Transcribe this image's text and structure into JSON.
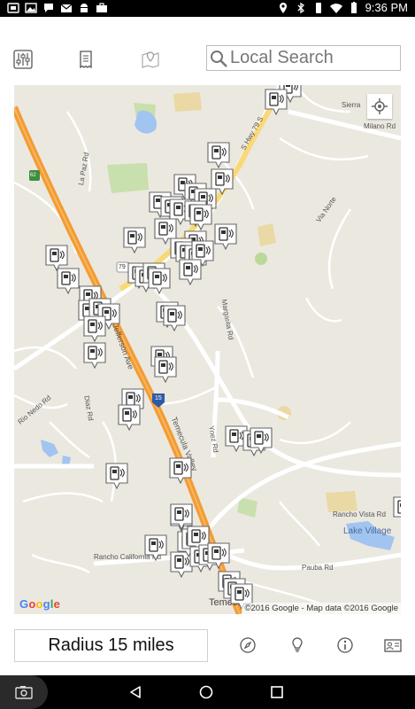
{
  "status_bar": {
    "time": "9:36 PM"
  },
  "toolbar": {
    "search_placeholder": "Local Search"
  },
  "map": {
    "google_logo": "Google",
    "attribution": "©2016 Google - Map data ©2016 Google",
    "street_labels": {
      "sierra": "Sierra",
      "milano": "Milano Rd",
      "hwy79": "S Hwy 79 S",
      "rancho_vista": "Rancho Vista Rd",
      "lake_village": "Lake Village",
      "rancho_california": "Rancho California Rd",
      "ynez": "Ynez Rd",
      "via_norte": "Via Norte",
      "la_paz": "La Paz Rd",
      "margarita": "Margarita Rd",
      "pauba": "Pauba Rd",
      "rio_nedo": "Rio Nedo Rd",
      "diaz": "Diaz Rd",
      "jefferson": "Jefferson Ave",
      "temecula": "Temecula",
      "temecula_valley": "Temecula Valley",
      "i15": "15",
      "route79": "79",
      "route62": "62"
    }
  },
  "bottom_bar": {
    "radius_label": "Radius 15 miles"
  }
}
